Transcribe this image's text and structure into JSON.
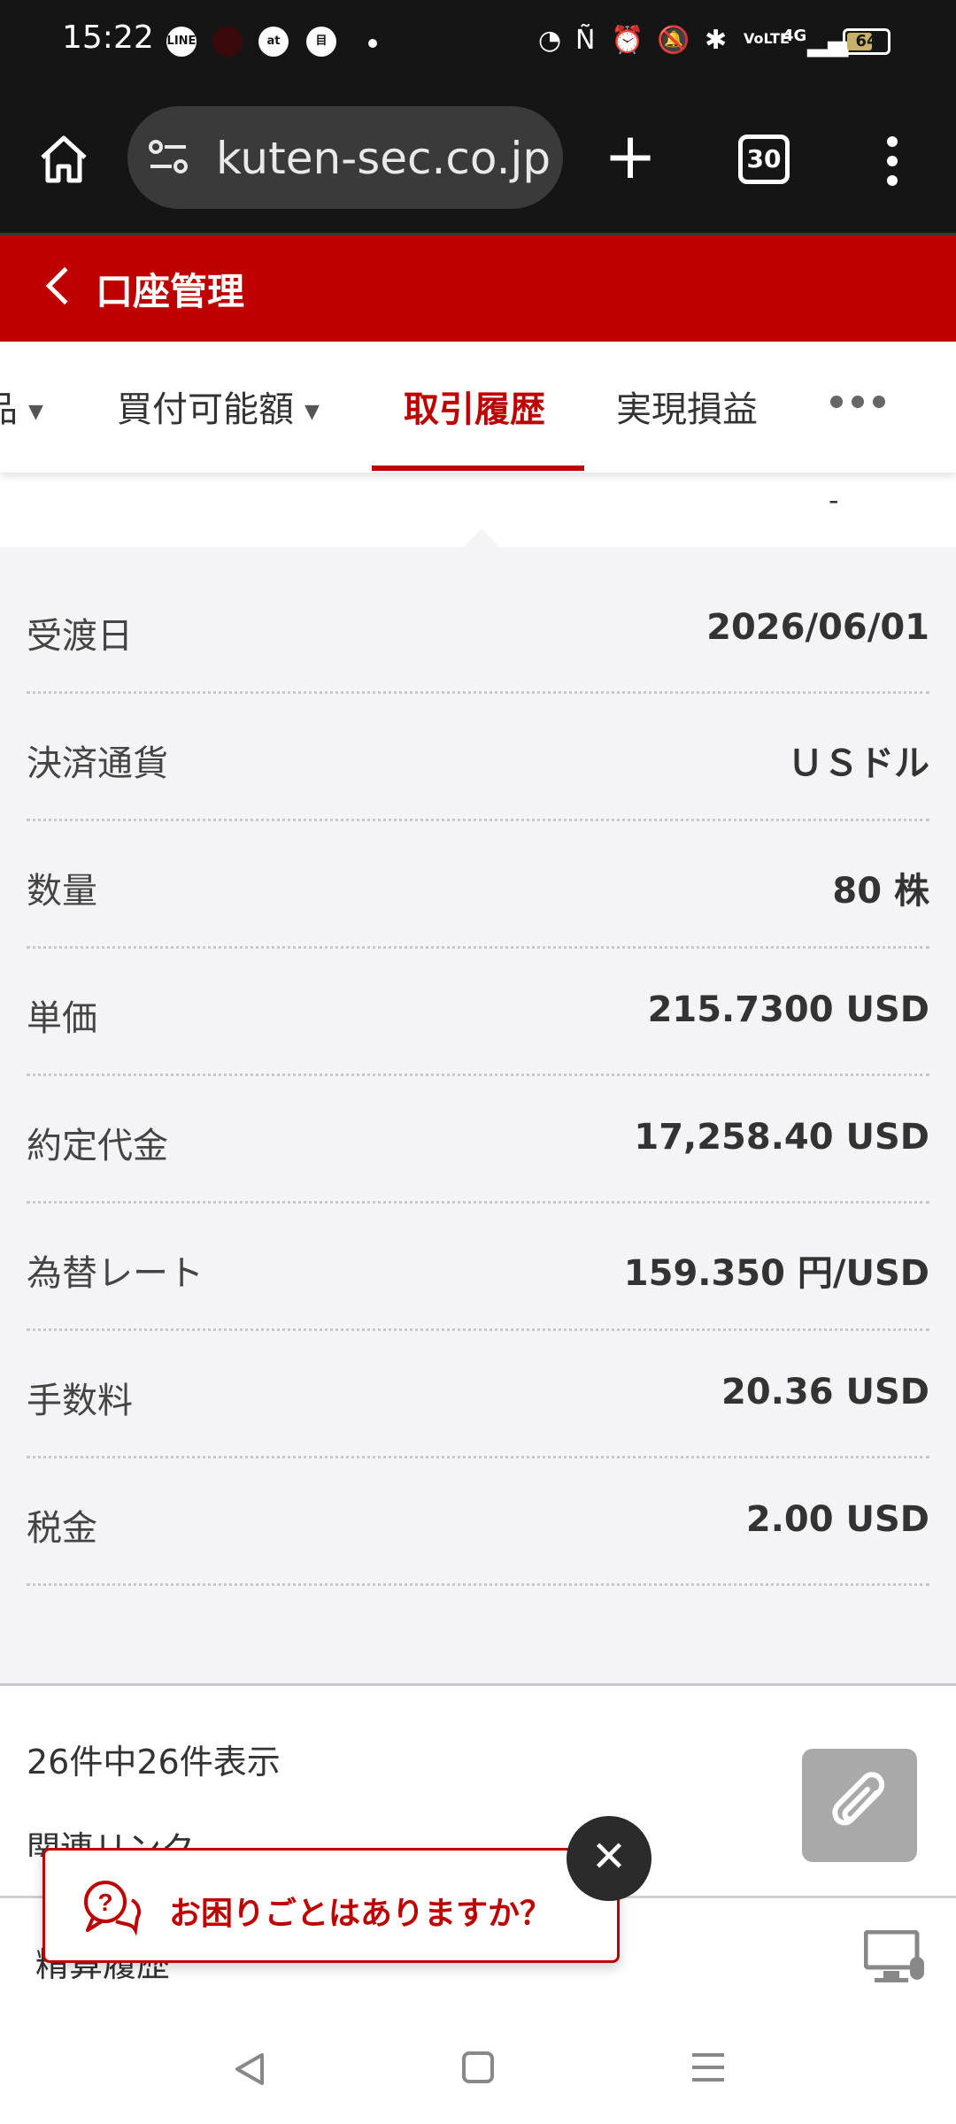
{
  "status_bar": {
    "time": "15:22",
    "notif_icons": [
      "LINE",
      "at",
      "目"
    ],
    "battery_level": "64",
    "network_label": "4G"
  },
  "browser": {
    "url": "kuten-sec.co.jp",
    "tabs_count": "30"
  },
  "header": {
    "title": "口座管理"
  },
  "tabs": [
    {
      "label": "品",
      "has_caret": true,
      "active": false
    },
    {
      "label": "買付可能額",
      "has_caret": true,
      "active": false
    },
    {
      "label": "取引履歴",
      "has_caret": false,
      "active": true
    },
    {
      "label": "実現損益",
      "has_caret": false,
      "active": false
    }
  ],
  "tab_caret": "▼",
  "prev_row_value": "-",
  "details": [
    {
      "label": "受渡日",
      "value": "2026/06/01"
    },
    {
      "label": "決済通貨",
      "value": "ＵＳドル"
    },
    {
      "label": "数量",
      "value": "80 株"
    },
    {
      "label": "単価",
      "value": "215.7300 USD"
    },
    {
      "label": "約定代金",
      "value": "17,258.40 USD"
    },
    {
      "label": "為替レート",
      "value": "159.350 円/USD"
    },
    {
      "label": "手数料",
      "value": "20.36 USD"
    },
    {
      "label": "税金",
      "value": "2.00 USD"
    }
  ],
  "footer": {
    "record_count": "26件中26件表示",
    "related_links": "関連リンク",
    "bottom_bar_text": "精算履歴"
  },
  "help_popup": {
    "text": "お困りごとはありますか？",
    "close_symbol": "✕"
  },
  "colors": {
    "brand_red": "#bf0000",
    "panel_bg": "#f4f4f6",
    "browser_bg": "#151515"
  }
}
